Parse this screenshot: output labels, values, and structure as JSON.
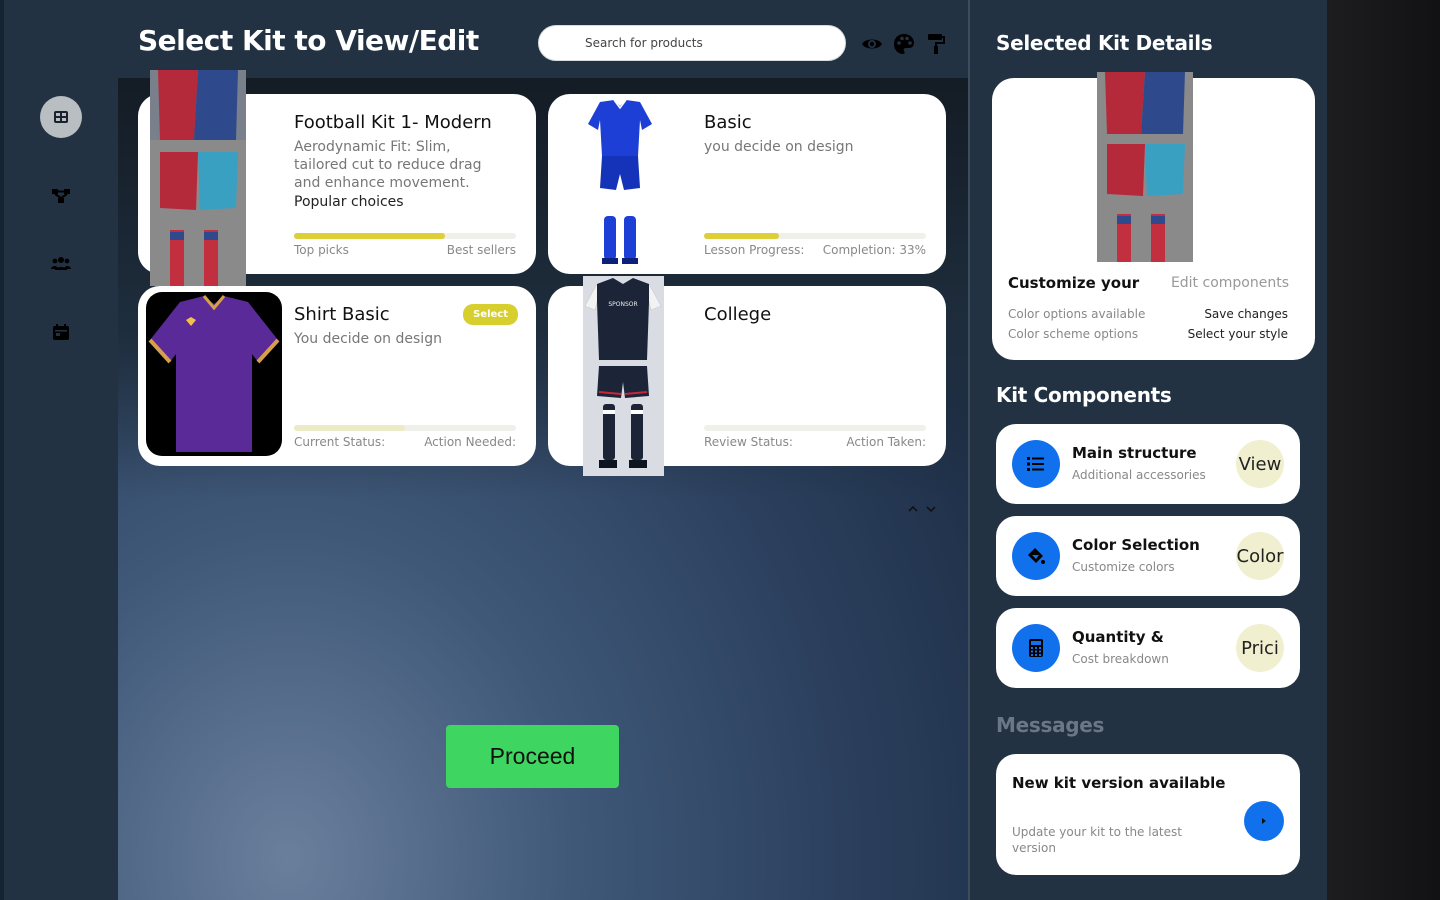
{
  "header": {
    "title": "Select Kit to View/Edit",
    "search_placeholder": "Search for products",
    "icons": [
      "eye-icon",
      "palette-icon",
      "paint-roller-icon"
    ]
  },
  "sidebar": {
    "items": [
      {
        "icon": "dashboard-icon",
        "active": true
      },
      {
        "icon": "hierarchy-icon",
        "active": false
      },
      {
        "icon": "users-icon",
        "active": false
      },
      {
        "icon": "calendar-icon",
        "active": false
      }
    ]
  },
  "kits": [
    {
      "title": "Football Kit 1- Modern",
      "description": "Aerodynamic Fit: Slim, tailored cut to reduce drag and enhance movement.",
      "extra": "Popular choices",
      "progress": 0.68,
      "label_left": "Top picks",
      "label_right": "Best sellers"
    },
    {
      "title": "Basic",
      "description": "you decide on design",
      "progress": 0.34,
      "label_left": "Lesson Progress:",
      "label_right": "Completion: 33%"
    },
    {
      "title": "Shirt Basic",
      "description": "You decide on design",
      "badge": "Select",
      "progress": 0.5,
      "label_left": "Current Status:",
      "label_right": "Action Needed:"
    },
    {
      "title": "College",
      "description": "",
      "progress": 0,
      "label_left": "Review Status:",
      "label_right": "Action Taken:"
    }
  ],
  "proceed_label": "Proceed",
  "details": {
    "heading": "Selected Kit Details",
    "customize": "Customize your",
    "edit": "Edit components",
    "color_options": "Color options available",
    "save_changes": "Save changes",
    "scheme_options": "Color scheme options",
    "select_style": "Select your style"
  },
  "components": {
    "heading": "Kit Components",
    "items": [
      {
        "title": "Main structure",
        "subtitle": "Additional accessories",
        "button": "View",
        "icon": "list-icon"
      },
      {
        "title": "Color Selection",
        "subtitle": "Customize colors",
        "button": "Color",
        "icon": "paint-bucket-icon"
      },
      {
        "title": "Quantity &",
        "subtitle": "Cost breakdown",
        "button": "Prici",
        "icon": "calculator-icon"
      }
    ]
  },
  "messages": {
    "heading": "Messages",
    "items": [
      {
        "title": "New kit version available",
        "body": "Update your kit to the latest version"
      }
    ]
  },
  "colors": {
    "accent_blue": "#1171ec",
    "progress_yellow": "#dccf38",
    "proceed_green": "#3ed661",
    "panel": "#233242"
  }
}
